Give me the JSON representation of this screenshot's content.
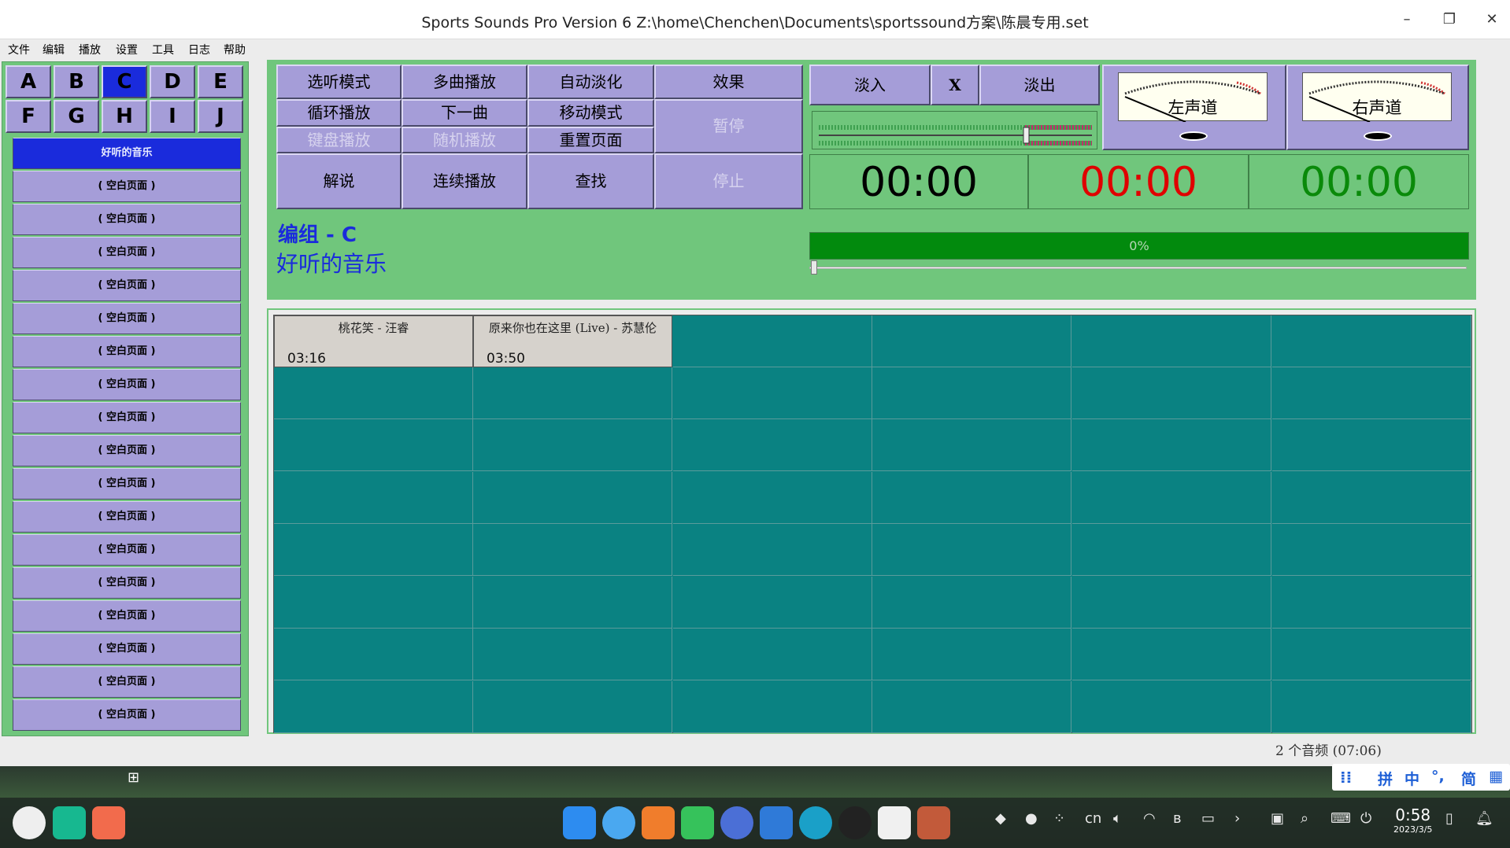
{
  "window": {
    "title": "Sports Sounds Pro Version 6 Z:\\home\\Chenchen\\Documents\\sportssound方案\\陈晨专用.set",
    "minimize": "–",
    "maximize": "❐",
    "close": "✕"
  },
  "menu": [
    "文件",
    "编辑",
    "播放",
    "设置",
    "工具",
    "日志",
    "帮助"
  ],
  "letters": [
    "A",
    "B",
    "C",
    "D",
    "E",
    "F",
    "G",
    "H",
    "I",
    "J"
  ],
  "active_letter": "C",
  "pages": [
    "好听的音乐",
    "( 空白页面 )",
    "( 空白页面 )",
    "( 空白页面 )",
    "( 空白页面 )",
    "( 空白页面 )",
    "( 空白页面 )",
    "( 空白页面 )",
    "( 空白页面 )",
    "( 空白页面 )",
    "( 空白页面 )",
    "( 空白页面 )",
    "( 空白页面 )",
    "( 空白页面 )",
    "( 空白页面 )",
    "( 空白页面 )",
    "( 空白页面 )",
    "( 空白页面 )"
  ],
  "controls": {
    "listen_mode": "选听模式",
    "multi_play": "多曲播放",
    "auto_fade": "自动淡化",
    "effects": "效果",
    "loop_play": "循环播放",
    "next_track": "下一曲",
    "move_mode": "移动模式",
    "pause": "暂停",
    "keyboard_play": "键盘播放",
    "random_play": "随机播放",
    "reset_page": "重置页面",
    "commentary": "解说",
    "continuous_play": "连续播放",
    "find": "查找",
    "stop": "停止",
    "fade_in": "淡入",
    "x": "X",
    "fade_out": "淡出"
  },
  "meters": {
    "left": "左声道",
    "right": "右声道"
  },
  "times": {
    "elapsed": "00:00",
    "remaining": "00:00",
    "total": "00:00"
  },
  "progress": {
    "label": "0%",
    "value": 0
  },
  "group": {
    "line1": "编组  - C",
    "line2": "好听的音乐"
  },
  "tracks": [
    {
      "title": "桃花笑 - 汪睿",
      "duration": "03:16"
    },
    {
      "title": "原来你也在这里 (Live) - 苏慧伦",
      "duration": "03:50"
    }
  ],
  "status": "2 个音频 (07:06)",
  "ime": {
    "a": "拼",
    "b": "中",
    "c": "°,",
    "d": "简"
  },
  "tray": {
    "lang": "cn"
  },
  "clock": {
    "time": "0:58",
    "date": "2023/3/5"
  },
  "colors": {
    "panel_green": "#70c67c",
    "button_purple": "#a59dd8",
    "active_blue": "#1a2bdc",
    "grid_teal": "#0a8282",
    "time_black": "#000000",
    "time_red": "#e00000",
    "time_green": "#0a8a0a"
  }
}
